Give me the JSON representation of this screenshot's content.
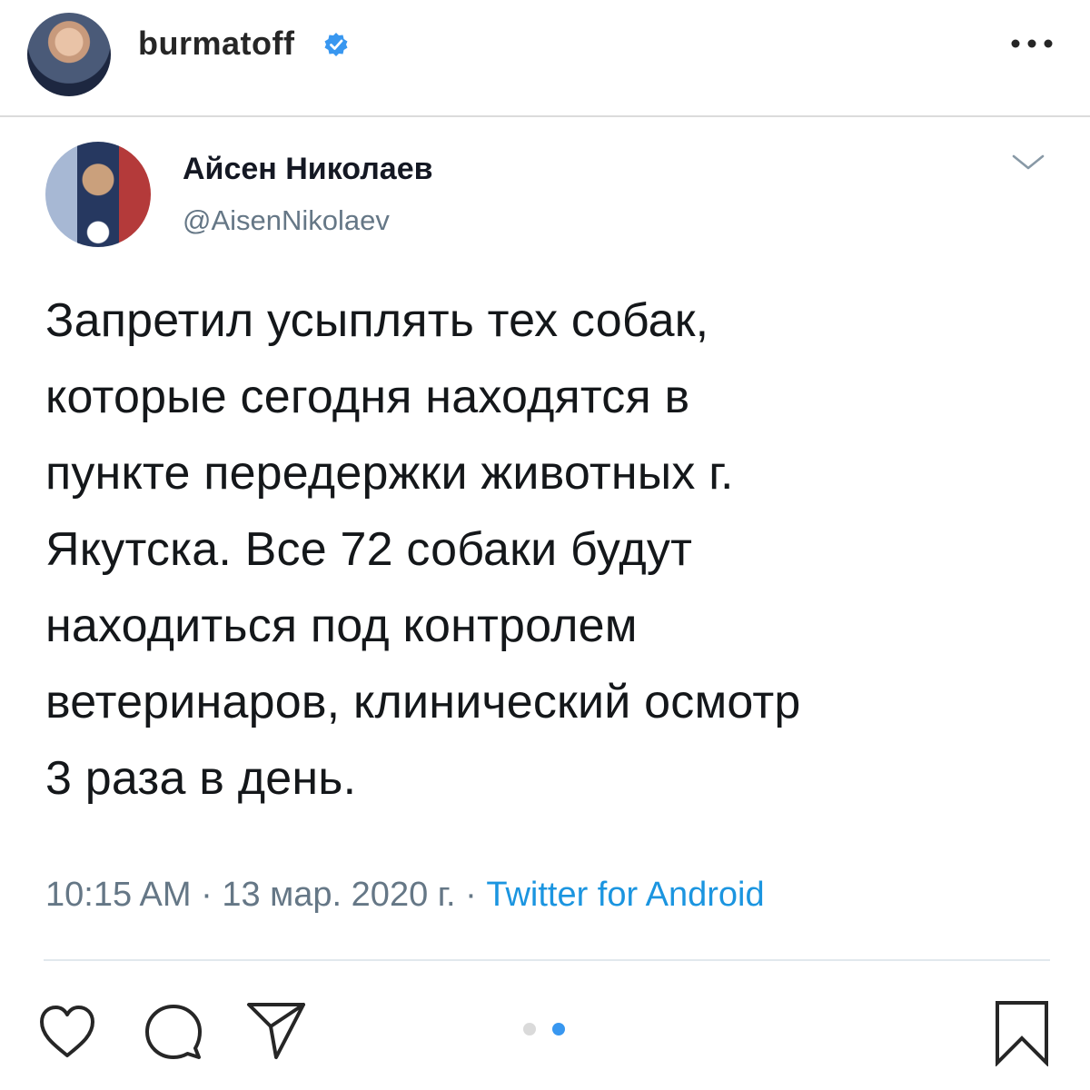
{
  "post": {
    "username": "burmatoff",
    "verified": true,
    "avatar_icon": "user-avatar",
    "more_icon": "more-horizontal-icon"
  },
  "tweet": {
    "display_name": "Айсен Николаев",
    "handle": "@AisenNikolaev",
    "text": "Запретил усыплять тех собак,\nкоторые сегодня находятся в\nпункте передержки животных г.\nЯкутска. Все 72 собаки будут\nнаходиться под контролем\nветеринаров, клинический осмотр\n3 раза в день.",
    "time": "10:15 AM",
    "date": "13 мар. 2020 г.",
    "separator": " · ",
    "source": "Twitter for Android"
  },
  "carousel": {
    "total": 2,
    "active_index": 1
  },
  "colors": {
    "verified": "#3897f0",
    "link": "#1b95e0",
    "dot_active": "#3897f0",
    "dot_inactive": "#dadada"
  }
}
